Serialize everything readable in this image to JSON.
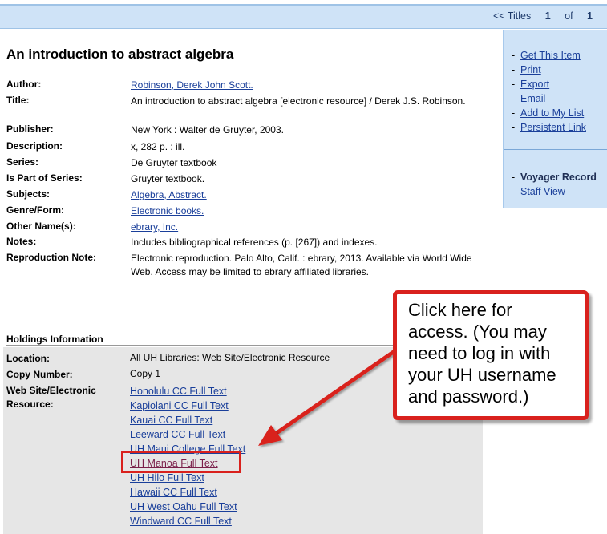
{
  "topnav": {
    "titles_link": "<< Titles",
    "page_current": "1",
    "of_label": "of",
    "page_total": "1"
  },
  "record_title": "An introduction to abstract algebra",
  "right_panel": {
    "actions": [
      "Get This Item",
      "Print",
      "Export",
      "Email",
      "Add to My List",
      "Persistent Link"
    ],
    "voyager_record": "Voyager Record",
    "staff_view": "Staff View"
  },
  "details": [
    {
      "label": "Author:",
      "value": "Robinson, Derek John Scott.",
      "link": true
    },
    {
      "label": "Title:",
      "value": "An introduction to abstract algebra [electronic resource] / Derek J.S. Robinson.",
      "link": false
    },
    {
      "label": "Publisher:",
      "value": "New York : Walter de Gruyter, 2003.",
      "link": false
    },
    {
      "label": "Description:",
      "value": "x, 282 p. : ill.",
      "link": false
    },
    {
      "label": "Series:",
      "value": "De Gruyter textbook",
      "link": false
    },
    {
      "label": "Is Part of Series:",
      "value": "Gruyter textbook.",
      "link": false
    },
    {
      "label": "Subjects:",
      "value": "Algebra, Abstract.",
      "link": true
    },
    {
      "label": "Genre/Form:",
      "value": "Electronic books.",
      "link": true
    },
    {
      "label": "Other Name(s):",
      "value": "ebrary, Inc.",
      "link": true
    },
    {
      "label": "Notes:",
      "value": "Includes bibliographical references (p. [267]) and indexes.",
      "link": false
    },
    {
      "label": "Reproduction Note:",
      "value": "Electronic reproduction. Palo Alto, Calif. : ebrary, 2013. Available via World Wide Web. Access may be limited to ebrary affiliated libraries.",
      "link": false
    }
  ],
  "holdings": {
    "header": "Holdings Information",
    "location_label": "Location:",
    "location_value": "All UH Libraries: Web Site/Electronic Resource",
    "copy_label": "Copy Number:",
    "copy_value": "Copy 1",
    "website_label_1": "Web Site/Electronic",
    "website_label_2": "Resource:",
    "links": [
      "Honolulu CC Full Text",
      "Kapiolani CC Full Text",
      "Kauai CC Full Text",
      "Leeward CC Full Text",
      "UH Maui College Full Text",
      "UH Manoa Full Text",
      "UH Hilo Full Text",
      "Hawaii CC Full Text",
      "UH West Oahu Full Text",
      "Windward CC Full Text"
    ]
  },
  "callout": {
    "text": "Click here for access.  (You may need to log in with your UH username and password.)",
    "color": "#d9211d"
  },
  "colors": {
    "link": "#1a3f9a",
    "visited_link": "#7a1f4a",
    "panel": "#cfe3f7",
    "highlight": "#d9211d"
  }
}
